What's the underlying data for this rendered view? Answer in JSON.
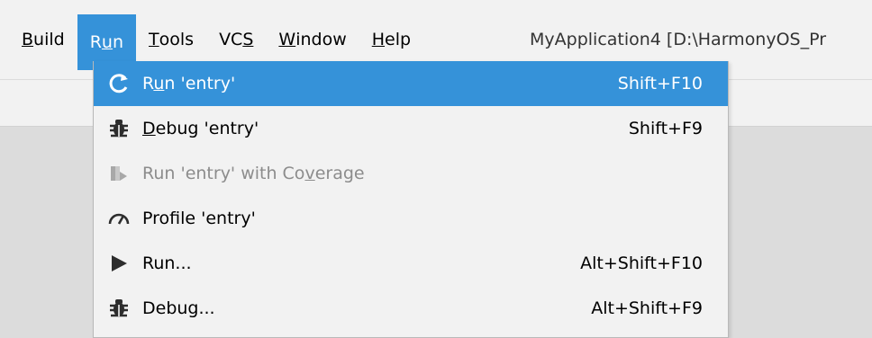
{
  "menubar": {
    "items": [
      {
        "label": "Build",
        "mnemonic_index": 0
      },
      {
        "label": "Run",
        "mnemonic_index": 1
      },
      {
        "label": "Tools",
        "mnemonic_index": 0
      },
      {
        "label": "VCS",
        "mnemonic_index": 2
      },
      {
        "label": "Window",
        "mnemonic_index": 0
      },
      {
        "label": "Help",
        "mnemonic_index": 0
      }
    ],
    "active_item": "Run",
    "window_title": "MyApplication4 [D:\\HarmonyOS_Pr"
  },
  "run_menu": {
    "items": [
      {
        "label": "Run 'entry'",
        "shortcut": "Shift+F10",
        "icon": "rerun-icon",
        "state": "selected"
      },
      {
        "label": "Debug 'entry'",
        "shortcut": "Shift+F9",
        "icon": "bug-icon",
        "state": "normal"
      },
      {
        "label": "Run 'entry' with Coverage",
        "shortcut": "",
        "icon": "coverage-icon",
        "state": "disabled"
      },
      {
        "label": "Profile 'entry'",
        "shortcut": "",
        "icon": "gauge-icon",
        "state": "normal"
      },
      {
        "label": "Run...",
        "shortcut": "Alt+Shift+F10",
        "icon": "play-icon",
        "state": "normal"
      },
      {
        "label": "Debug...",
        "shortcut": "Alt+Shift+F9",
        "icon": "bug-icon",
        "state": "normal"
      }
    ]
  },
  "colors": {
    "accent": "#3592d9",
    "menubar_bg": "#f2f2f2",
    "disabled_text": "#8c8c8c",
    "editor_bg": "#dcdcdc"
  }
}
